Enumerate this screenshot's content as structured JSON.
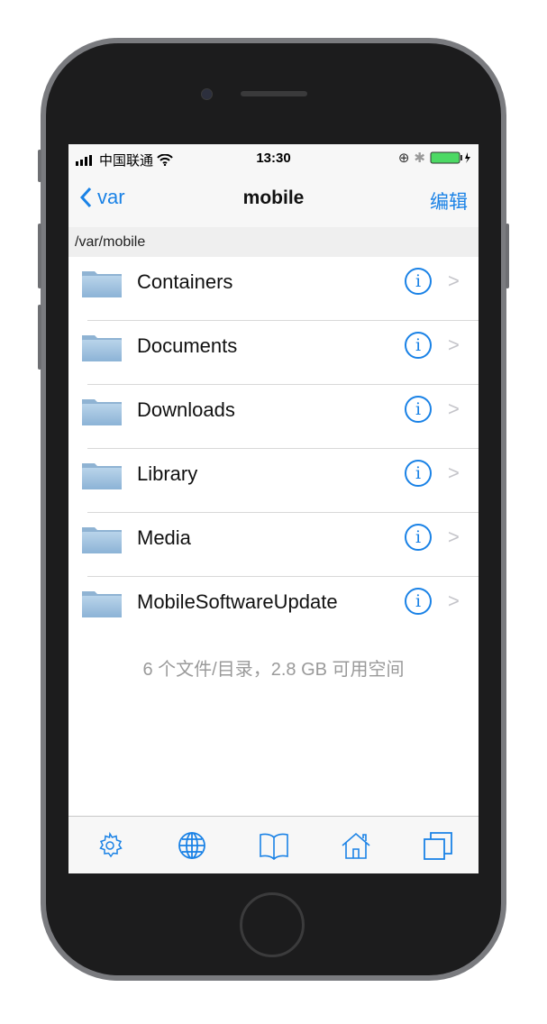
{
  "status_bar": {
    "carrier": "中国联通",
    "time": "13:30",
    "battery_color": "#4cd964"
  },
  "nav": {
    "back_label": "var",
    "title": "mobile",
    "edit_label": "编辑"
  },
  "path": "/var/mobile",
  "items": [
    {
      "name": "Containers"
    },
    {
      "name": "Documents"
    },
    {
      "name": "Downloads"
    },
    {
      "name": "Library"
    },
    {
      "name": "Media"
    },
    {
      "name": "MobileSoftwareUpdate"
    }
  ],
  "footer": "6 个文件/目录，2.8 GB 可用空间",
  "toolbar": [
    "gear-icon",
    "globe-icon",
    "book-icon",
    "home-icon",
    "windows-icon"
  ],
  "accent": "#1a82e6"
}
